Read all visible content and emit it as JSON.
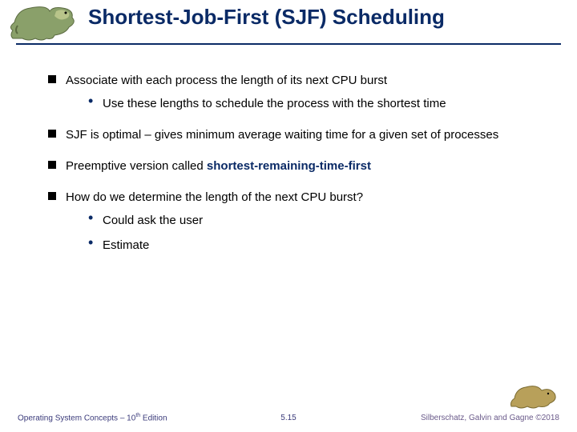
{
  "title": "Shortest-Job-First (SJF) Scheduling",
  "bullets": {
    "b1": "Associate with each process the length of its next CPU burst",
    "b1_sub1": "Use these lengths to schedule the process with the shortest time",
    "b2": "SJF is optimal – gives minimum average waiting time for a given set of processes",
    "b3_pre": "Preemptive version called ",
    "b3_term": "shortest-remaining-time-first",
    "b4": "How do we determine the length of the next CPU burst?",
    "b4_sub1": "Could ask the user",
    "b4_sub2": "Estimate"
  },
  "footer": {
    "left_pre": "Operating System Concepts – 10",
    "left_sup": "th",
    "left_post": " Edition",
    "center": "5.15",
    "right": "Silberschatz, Galvin and Gagne ©2018"
  },
  "icons": {
    "dino_tl": "dinosaur-icon",
    "dino_br": "dinosaur-icon"
  }
}
